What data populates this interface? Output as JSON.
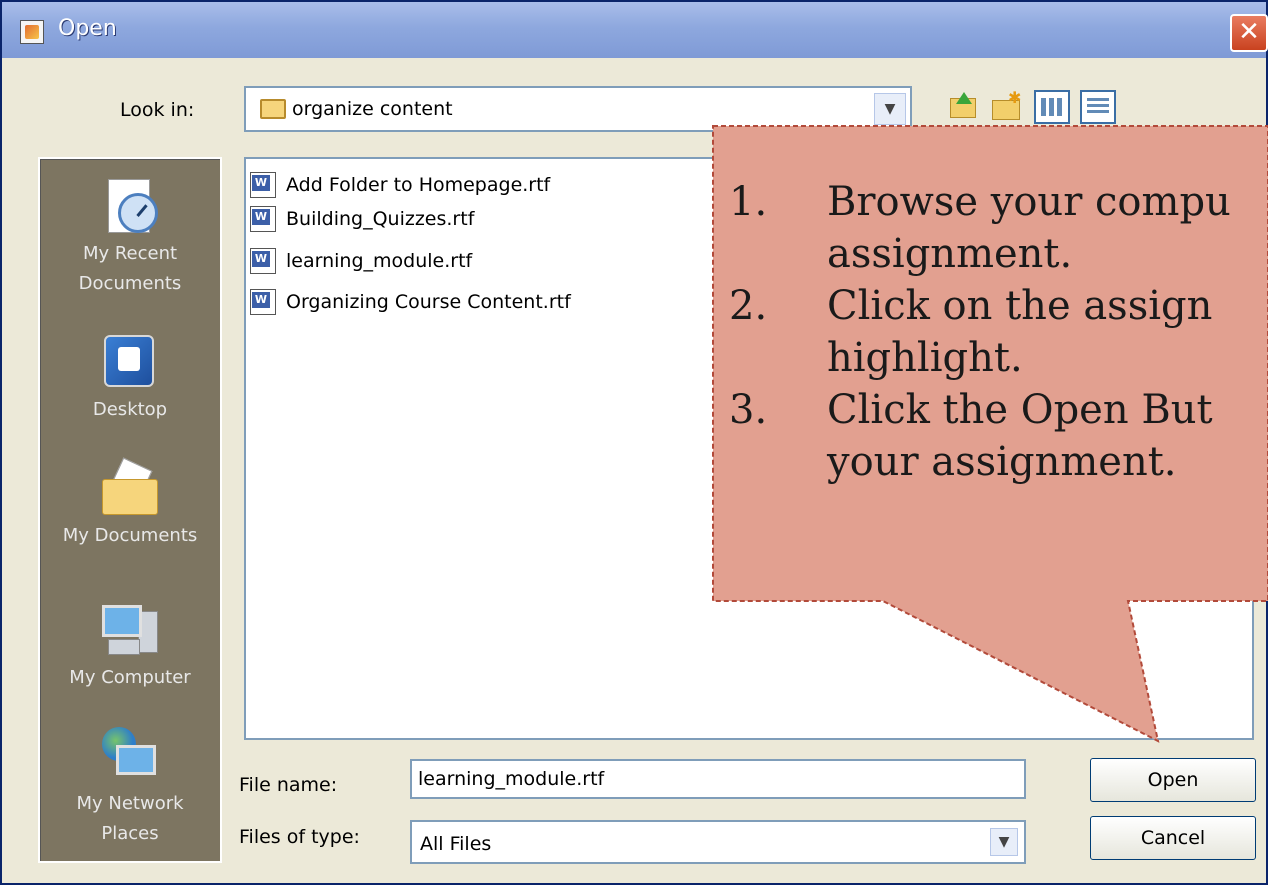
{
  "window": {
    "title": "Open",
    "close_label": "✕"
  },
  "lookin": {
    "label": "Look in:",
    "value": "organize content"
  },
  "places": [
    {
      "label": "My Recent Documents",
      "icon": "recent-documents-icon"
    },
    {
      "label": "Desktop",
      "icon": "desktop-icon"
    },
    {
      "label": "My Documents",
      "icon": "my-documents-icon"
    },
    {
      "label": "My Computer",
      "icon": "my-computer-icon"
    },
    {
      "label": "My Network Places",
      "icon": "network-places-icon"
    }
  ],
  "places_split": {
    "recent_1": "My Recent",
    "recent_2": "Documents",
    "network_1": "My Network",
    "network_2": "Places"
  },
  "files": [
    "Add Folder to Homepage.rtf",
    "Building_Quizzes.rtf",
    "learning_module.rtf",
    "Organizing Course Content.rtf"
  ],
  "filename": {
    "label": "File name:",
    "value": "learning_module.rtf"
  },
  "filetype": {
    "label": "Files of type:",
    "value": "All Files"
  },
  "buttons": {
    "open": "Open",
    "cancel": "Cancel"
  },
  "callout": {
    "steps": [
      {
        "num": "1.",
        "line1": "Browse your compu",
        "line2": "assignment."
      },
      {
        "num": "2.",
        "line1": "Click on the assign",
        "line2": "highlight."
      },
      {
        "num": "3.",
        "line1": "Click the Open But",
        "line2": "your assignment."
      }
    ],
    "colors": {
      "fill": "#e2a090",
      "border": "#b24a3a"
    }
  }
}
